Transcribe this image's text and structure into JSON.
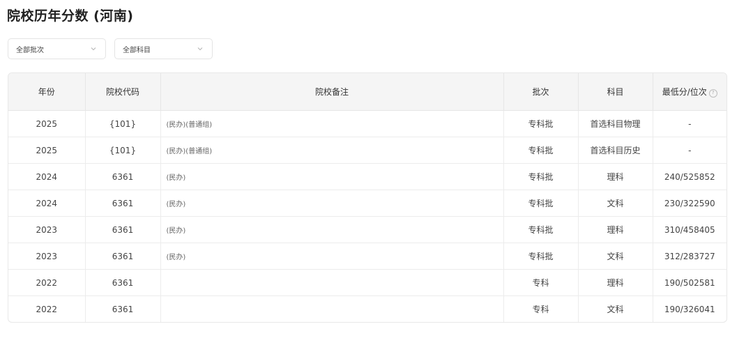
{
  "page": {
    "title": "院校历年分数 (河南)"
  },
  "filters": {
    "batch": {
      "selected": "全部批次",
      "icon": "chevron-down-icon"
    },
    "subject": {
      "selected": "全部科目",
      "icon": "chevron-down-icon"
    }
  },
  "table": {
    "headers": {
      "year": "年份",
      "code": "院校代码",
      "note": "院校备注",
      "batch": "批次",
      "subject": "科目",
      "score": "最低分/位次"
    },
    "help_icon_glyph": "?",
    "rows": [
      {
        "year": "2025",
        "code": "{101}",
        "note": "(民办)(普通组)",
        "batch": "专科批",
        "subject": "首选科目物理",
        "score": "-"
      },
      {
        "year": "2025",
        "code": "{101}",
        "note": "(民办)(普通组)",
        "batch": "专科批",
        "subject": "首选科目历史",
        "score": "-"
      },
      {
        "year": "2024",
        "code": "6361",
        "note": "(民办)",
        "batch": "专科批",
        "subject": "理科",
        "score": "240/525852"
      },
      {
        "year": "2024",
        "code": "6361",
        "note": "(民办)",
        "batch": "专科批",
        "subject": "文科",
        "score": "230/322590"
      },
      {
        "year": "2023",
        "code": "6361",
        "note": "(民办)",
        "batch": "专科批",
        "subject": "理科",
        "score": "310/458405"
      },
      {
        "year": "2023",
        "code": "6361",
        "note": "(民办)",
        "batch": "专科批",
        "subject": "文科",
        "score": "312/283727"
      },
      {
        "year": "2022",
        "code": "6361",
        "note": "",
        "batch": "专科",
        "subject": "理科",
        "score": "190/502581"
      },
      {
        "year": "2022",
        "code": "6361",
        "note": "",
        "batch": "专科",
        "subject": "文科",
        "score": "190/326041"
      }
    ]
  }
}
